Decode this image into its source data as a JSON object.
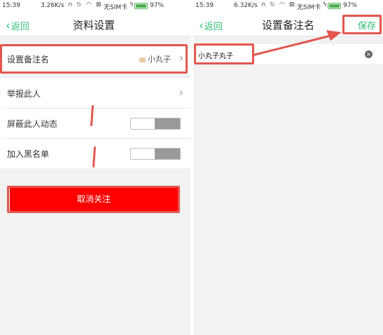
{
  "left": {
    "status": {
      "time": "15:39",
      "speed": "3.26K/s",
      "sim": "无SIM卡",
      "battery": "97%"
    },
    "nav": {
      "back": "返回",
      "title": "资料设置"
    },
    "rows": {
      "remark": {
        "label": "设置备注名",
        "value": "小丸子"
      },
      "report": {
        "label": "举报此人"
      },
      "block_moments": {
        "label": "屏蔽此人动态"
      },
      "blacklist": {
        "label": "加入黑名单"
      }
    },
    "unfollow": "取消关注"
  },
  "right": {
    "status": {
      "time": "15:39",
      "speed": "6.32K/s",
      "sim": "无SIM卡",
      "battery": "97%"
    },
    "nav": {
      "back": "返回",
      "title": "设置备注名",
      "save": "保存"
    },
    "input": {
      "value": "小丸子丸子"
    }
  },
  "colors": {
    "accent": "#2cbf73",
    "highlight": "#e2564e",
    "danger": "#ff0000"
  },
  "icons": [
    "headphones-icon",
    "alarm-off-icon",
    "wifi-icon",
    "no-sim-icon",
    "charging-icon",
    "battery-icon",
    "chevron-left-icon",
    "chevron-right-icon",
    "clear-icon"
  ]
}
